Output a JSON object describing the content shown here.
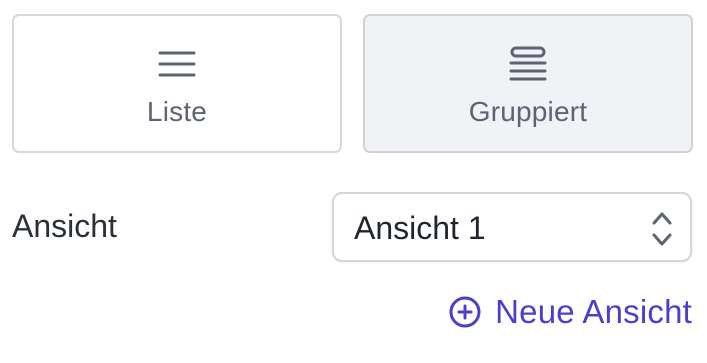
{
  "layout_options": [
    {
      "label": "Liste",
      "icon": "list-icon",
      "selected": false
    },
    {
      "label": "Gruppiert",
      "icon": "grouped-list-icon",
      "selected": true
    }
  ],
  "view": {
    "label": "Ansicht",
    "selected_value": "Ansicht 1",
    "icon": "chevron-up-down-icon"
  },
  "new_view": {
    "label": "Neue Ansicht",
    "icon": "plus-circle-icon"
  },
  "colors": {
    "accent": "#4a3fd0",
    "selected_bg": "#f1f2f6",
    "border": "#d6d8dd",
    "text_muted": "#5d6370",
    "text": "#2a2f38"
  }
}
